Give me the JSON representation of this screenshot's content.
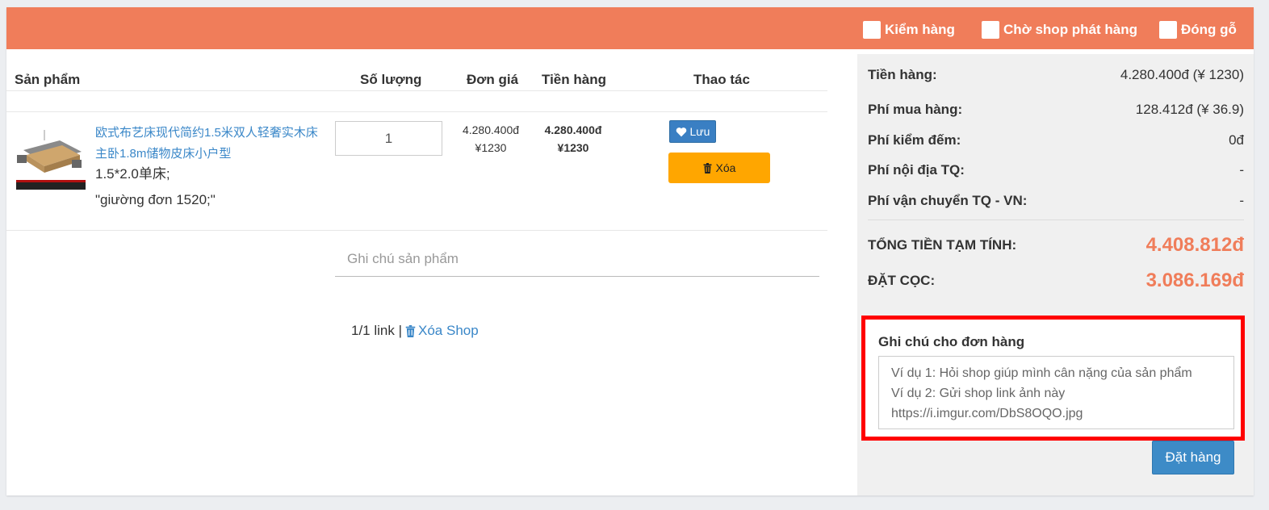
{
  "topbar": {
    "options": [
      {
        "label": "Kiểm hàng",
        "checked": false
      },
      {
        "label": "Chờ shop phát hàng",
        "checked": false
      },
      {
        "label": "Đóng gỗ",
        "checked": false
      }
    ],
    "color": "#f07d5a"
  },
  "table": {
    "headers": {
      "product": "Sản phẩm",
      "quantity": "Số lượng",
      "unit_price": "Đơn giá",
      "amount": "Tiền hàng",
      "actions": "Thao tác"
    }
  },
  "item": {
    "name": "欧式布艺床现代简约1.5米双人轻奢实木床主卧1.8m储物皮床小户型",
    "variant": "1.5*2.0单床;",
    "variant_note": "\"giường đơn 1520;\"",
    "quantity": "1",
    "unit_price_vnd": "4.280.400đ",
    "unit_price_cny": "¥1230",
    "amount_vnd": "4.280.400đ",
    "amount_cny": "¥1230",
    "save_label": "Lưu",
    "delete_label": "Xóa",
    "note_placeholder": "Ghi chú sản phẩm"
  },
  "shop_footer": {
    "link_count": "1/1 link |",
    "delete_shop_label": "Xóa Shop"
  },
  "summary": {
    "rows": [
      {
        "label": "Tiền hàng:",
        "value": "4.280.400đ (¥ 1230)"
      },
      {
        "label": "Phí mua hàng:",
        "value": "128.412đ (¥ 36.9)"
      },
      {
        "label": "Phí kiểm đếm:",
        "value": "0đ"
      },
      {
        "label": "Phí nội địa TQ:",
        "value": "-"
      },
      {
        "label": "Phí vận chuyển TQ - VN:",
        "value": "-"
      }
    ],
    "total_label": "TỔNG TIỀN TẠM TÍNH:",
    "total_value": "4.408.812đ",
    "deposit_label": "ĐẶT CỌC:",
    "deposit_value": "3.086.169đ",
    "accent_color": "#f07d5a"
  },
  "order_note": {
    "label": "Ghi chú cho đơn hàng",
    "placeholder": "Ví dụ 1: Hỏi shop giúp mình cân nặng của sản phẩm\nVí dụ 2: Gửi shop link ảnh này https://i.imgur.com/DbS8OQO.jpg"
  },
  "order_button_label": "Đặt hàng",
  "icons": {
    "save": "heart-icon",
    "delete": "trash-icon",
    "delete_shop": "trash-icon"
  }
}
